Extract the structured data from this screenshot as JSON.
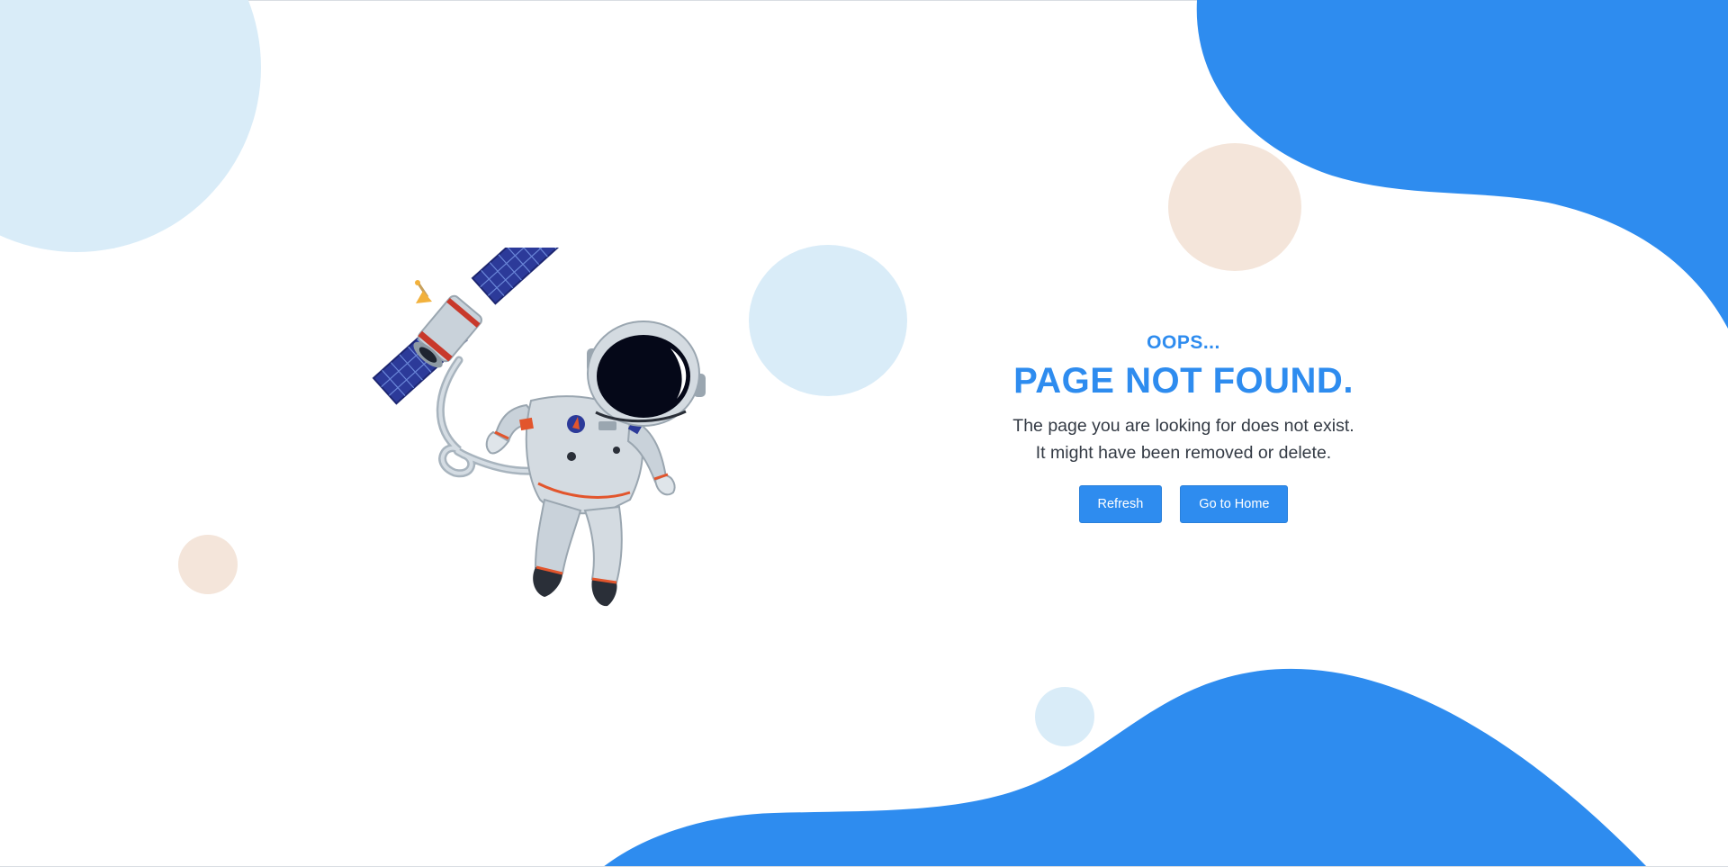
{
  "message": {
    "oops": "OOPS...",
    "title": "PAGE NOT FOUND.",
    "line1": "The page you are looking for does not exist.",
    "line2": "It might have been removed or delete."
  },
  "buttons": {
    "refresh": "Refresh",
    "home": "Go to Home"
  },
  "colors": {
    "accent": "#2e8cef",
    "light_blue_bubble": "#d9ecf8",
    "peach_bubble": "#f4e5da"
  }
}
